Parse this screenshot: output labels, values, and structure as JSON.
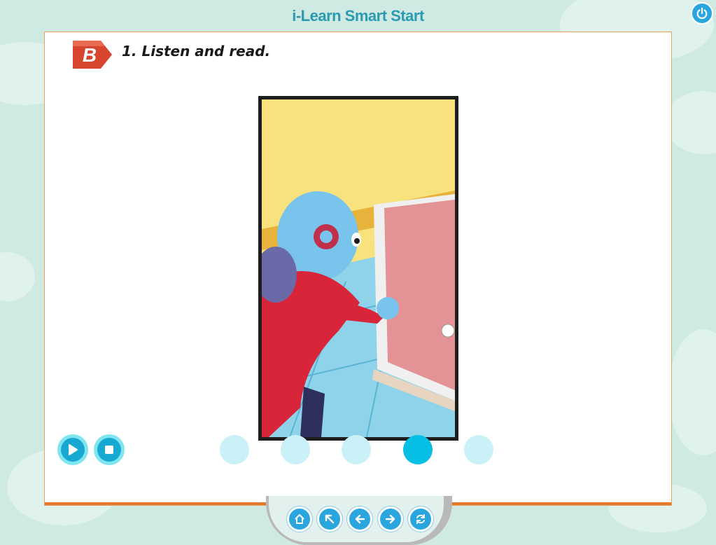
{
  "app": {
    "title": "i-Learn Smart Start"
  },
  "icons": {
    "power": "power-icon",
    "section_badge": "section-b-badge",
    "play": "play-icon",
    "stop": "stop-icon",
    "home": "home-icon",
    "menu": "arrow-up-left-icon",
    "previous": "arrow-left-icon",
    "next": "arrow-right-icon",
    "replay": "refresh-icon"
  },
  "lesson": {
    "section_letter": "B",
    "instruction": "1. Listen and read."
  },
  "pagination": {
    "total": 5,
    "active_index": 4
  },
  "colors": {
    "accent": "#2aa6df",
    "badge": "#d8452e",
    "panel_border": "#e7a25e",
    "active_dot": "#05bfe4",
    "inactive_dot": "#c9f1f7"
  }
}
